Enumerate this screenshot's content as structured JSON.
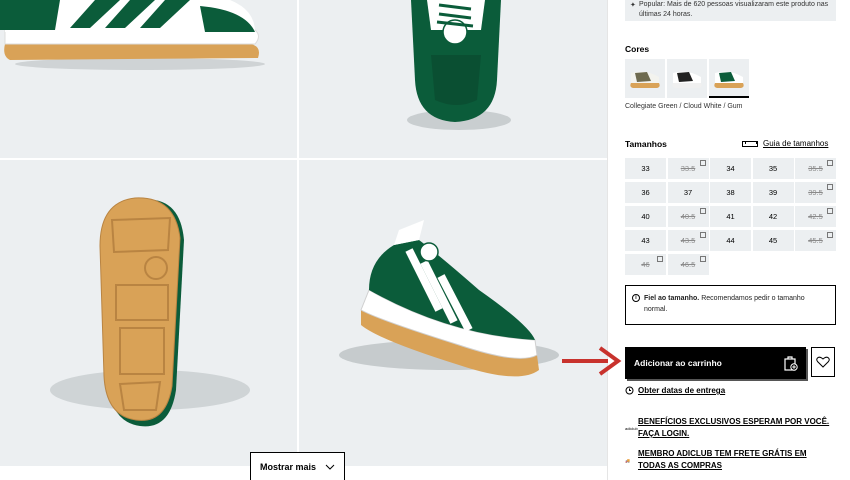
{
  "gallery": {
    "show_more_label": "Mostrar mais"
  },
  "panel": {
    "popular_text": "Popular: Mais de 620 pessoas visualizaram este produto nas últimas 24 horas.",
    "colors_label": "Cores",
    "color_name": "Collegiate Green / Cloud White / Gum",
    "sizes_label": "Tamanhos",
    "size_guide_label": "Guia de tamanhos",
    "sizes": [
      {
        "label": "33",
        "available": true
      },
      {
        "label": "33.5",
        "available": false
      },
      {
        "label": "34",
        "available": true
      },
      {
        "label": "35",
        "available": true
      },
      {
        "label": "35.5",
        "available": false
      },
      {
        "label": "36",
        "available": true
      },
      {
        "label": "37",
        "available": true
      },
      {
        "label": "38",
        "available": true
      },
      {
        "label": "39",
        "available": true
      },
      {
        "label": "39.5",
        "available": false
      },
      {
        "label": "40",
        "available": true
      },
      {
        "label": "40.5",
        "available": false
      },
      {
        "label": "41",
        "available": true
      },
      {
        "label": "42",
        "available": true
      },
      {
        "label": "42.5",
        "available": false
      },
      {
        "label": "43",
        "available": true
      },
      {
        "label": "43.5",
        "available": false
      },
      {
        "label": "44",
        "available": true
      },
      {
        "label": "45",
        "available": true
      },
      {
        "label": "45.5",
        "available": false
      },
      {
        "label": "46",
        "available": false
      },
      {
        "label": "46.5",
        "available": false
      }
    ],
    "fit_bold": "Fiel ao tamanho.",
    "fit_text": "Recomendamos pedir o tamanho normal.",
    "add_to_cart_label": "Adicionar ao carrinho",
    "delivery_label": "Obter datas de entrega",
    "perk_1": "BENEFÍCIOS EXCLUSIVOS ESPERAM POR VOCÊ. FAÇA LOGIN.",
    "perk_2": "MEMBRO ADICLUB TEM FRETE GRÁTIS EM TODAS AS COMPRAS"
  },
  "colors": {
    "shoe_green": "#0b5c3a",
    "gum": "#d8a55c",
    "tile_bg": "#eceff1",
    "annotation_red": "#c8322d"
  }
}
